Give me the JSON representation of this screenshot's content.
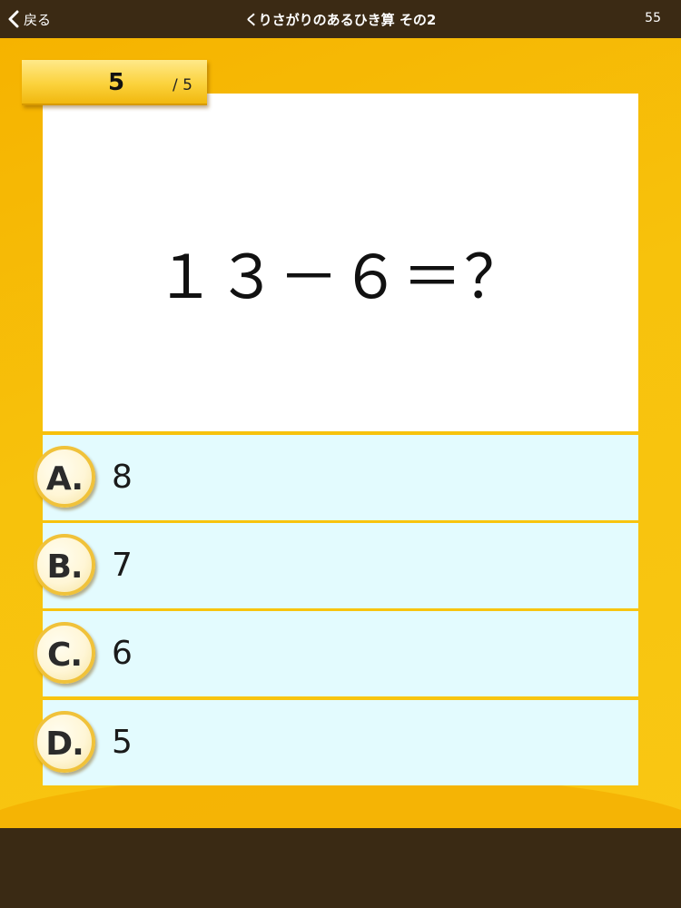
{
  "nav": {
    "back_label": "戻る",
    "title": "くりさがりのあるひき算 その2",
    "right_value": "55"
  },
  "counter": {
    "current": "5",
    "total": "/ 5"
  },
  "question": {
    "text": "１３－６＝？"
  },
  "choices": [
    {
      "letter": "A.",
      "value": "8"
    },
    {
      "letter": "B.",
      "value": "7"
    },
    {
      "letter": "C.",
      "value": "6"
    },
    {
      "letter": "D.",
      "value": "5"
    }
  ],
  "colors": {
    "bar": "#3b2a14",
    "field": "#f7c20c",
    "choice_bg": "#e3fbfe",
    "badge_ring": "#f0c23a"
  }
}
